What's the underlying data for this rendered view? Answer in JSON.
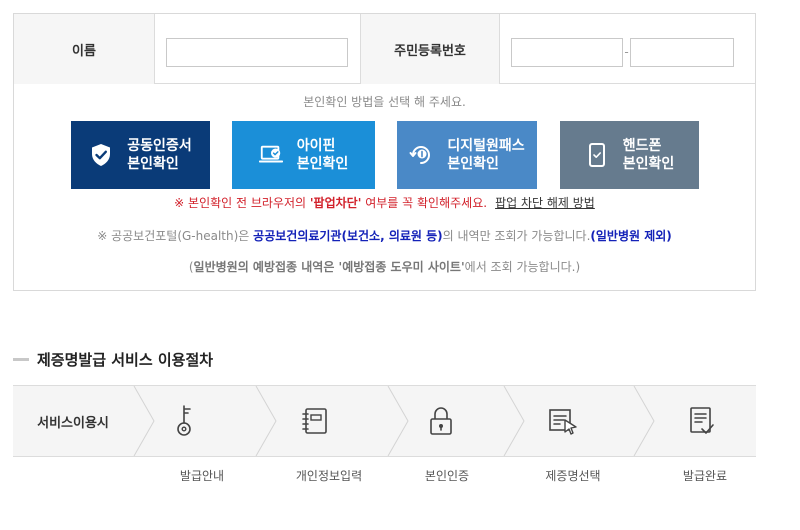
{
  "form": {
    "name_label": "이름",
    "ssn_label": "주민등록번호",
    "name_value": "",
    "ssn_front_value": "",
    "ssn_back_value": "",
    "ssn_separator": "-"
  },
  "auth": {
    "guide": "본인확인 방법을 선택 해 주세요.",
    "buttons": [
      {
        "line1": "공동인증서",
        "line2": "본인확인",
        "icon": "shield-check-icon",
        "color": "#0a3b78"
      },
      {
        "line1": "아이핀",
        "line2": "본인확인",
        "icon": "monitor-check-icon",
        "color": "#1b8fd8"
      },
      {
        "line1": "디지털원패스",
        "line2": "본인확인",
        "icon": "digital-onepass-icon",
        "color": "#4a89c7"
      },
      {
        "line1": "핸드폰",
        "line2": "본인확인",
        "icon": "smartphone-icon",
        "color": "#667b8e"
      }
    ]
  },
  "notes": {
    "popup_pre": "※ 본인확인 전 브라우저의 ",
    "popup_bold": "'팝업차단'",
    "popup_post": " 여부를 꼭 확인해주세요.",
    "popup_link": "팝업 차단 해제 방법",
    "info1_pre": "※ 공공보건포털(G-health)은 ",
    "info1_bold": "공공보건의료기관(보건소, 의료원 등)",
    "info1_mid": "의 내역만 조회가 가능합니다.",
    "info1_bold2": "(일반병원 제외)",
    "info2_pre": "(",
    "info2_bold1": "일반병원의 예방접종 내역은 '예방접종 도우미 사이트'",
    "info2_post": "에서 조회 가능합니다.)"
  },
  "process": {
    "title": "제증명발급 서비스 이용절차",
    "start_label": "서비스이용시",
    "steps": [
      {
        "label": "발급안내",
        "icon": "key-icon"
      },
      {
        "label": "개인정보입력",
        "icon": "notebook-icon"
      },
      {
        "label": "본인인증",
        "icon": "lock-icon"
      },
      {
        "label": "제증명선택",
        "icon": "document-select-icon"
      },
      {
        "label": "발급완료",
        "icon": "document-complete-icon"
      }
    ]
  }
}
